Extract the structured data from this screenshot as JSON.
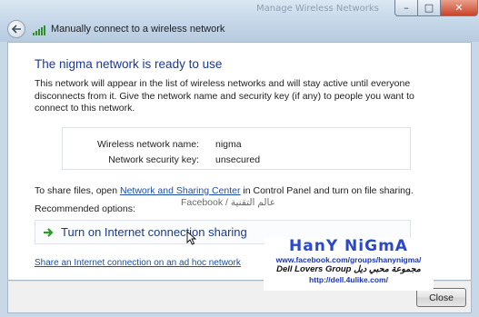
{
  "window": {
    "title": "Manually connect to a wireless network",
    "caption_ghost": "Manage Wireless Networks",
    "minimize_glyph": "–",
    "maximize_glyph": "□",
    "close_glyph": "✕"
  },
  "main": {
    "heading": "The nigma network is ready to use",
    "description": "This network will appear in the list of wireless networks and will stay active until everyone disconnects from it. Give the network name and security key (if any) to people you want to connect to this network.",
    "network_name_label": "Wireless network name:",
    "network_name_value": "nigma",
    "security_label": "Network security key:",
    "security_value": "unsecured",
    "security_overlay": "Facebook / عالم التقنية",
    "share_prefix": "To share files, open ",
    "share_link": "Network and Sharing Center",
    "share_suffix": " in Control Panel and turn on file sharing.",
    "recommended_label": "Recommended options:",
    "option_label": "Turn on Internet connection sharing",
    "adhoc_link": "Share an Internet connection on an ad hoc network"
  },
  "footer": {
    "close_label": "Close"
  },
  "watermark": {
    "name": "HanY NiGmA",
    "facebook": "www.facebook.com/groups/hanynigma/",
    "group": "Dell Lovers Group مجموعة محبي ديل",
    "url": "http://dell.4ulike.com/"
  },
  "colors": {
    "heading": "#1a3a8e",
    "link": "#1a4fa8",
    "watermark_name": "#2b48c8"
  }
}
